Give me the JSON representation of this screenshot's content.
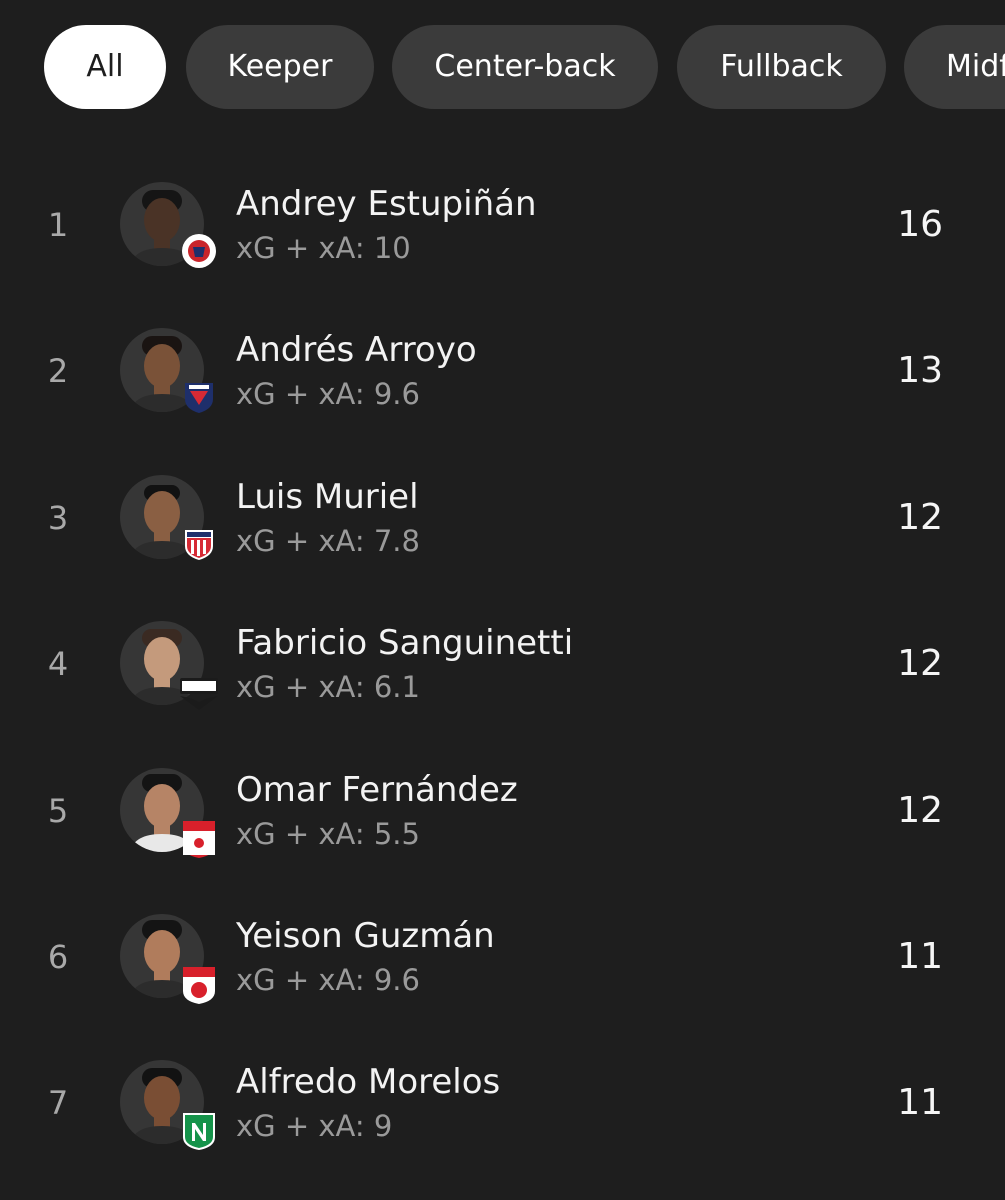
{
  "filters": [
    {
      "label": "All",
      "active": true
    },
    {
      "label": "Keeper",
      "active": false
    },
    {
      "label": "Center-back",
      "active": false
    },
    {
      "label": "Fullback",
      "active": false
    },
    {
      "label": "Midfielder",
      "active": false
    }
  ],
  "players": [
    {
      "rank": "1",
      "name": "Andrey Estupiñán",
      "stat": "xG + xA: 10",
      "value": "16",
      "badge": "pasto-crest-icon",
      "skin": "#4a3326",
      "hair": "#151515",
      "badge_color": "#c9242b"
    },
    {
      "rank": "2",
      "name": "Andrés Arroyo",
      "stat": "xG + xA: 9.6",
      "value": "13",
      "badge": "fortaleza-crest-icon",
      "skin": "#7a5238",
      "hair": "#1a1412",
      "badge_color": "#1e2f6b"
    },
    {
      "rank": "3",
      "name": "Luis Muriel",
      "stat": "xG + xA: 7.8",
      "value": "12",
      "badge": "junior-crest-icon",
      "skin": "#8a5f43",
      "hair": "#121212",
      "badge_color": "#d62a35"
    },
    {
      "rank": "4",
      "name": "Fabricio Sanguinetti",
      "stat": "xG + xA: 6.1",
      "value": "12",
      "badge": "internacional-bogota-crest-icon",
      "skin": "#c49a7c",
      "hair": "#3a2a22",
      "badge_color": "#1b1b1b"
    },
    {
      "rank": "5",
      "name": "Omar Fernández",
      "stat": "xG + xA: 5.5",
      "value": "12",
      "badge": "santa-fe-crest-icon",
      "skin": "#b68466",
      "hair": "#141414",
      "badge_color": "#d8202b"
    },
    {
      "rank": "6",
      "name": "Yeison Guzmán",
      "stat": "xG + xA: 9.6",
      "value": "11",
      "badge": "america-crest-icon",
      "skin": "#b07c5c",
      "hair": "#141414",
      "badge_color": "#d8202b"
    },
    {
      "rank": "7",
      "name": "Alfredo Morelos",
      "stat": "xG + xA: 9",
      "value": "11",
      "badge": "nacional-crest-icon",
      "skin": "#7a4e34",
      "hair": "#121212",
      "badge_color": "#15934a"
    }
  ]
}
